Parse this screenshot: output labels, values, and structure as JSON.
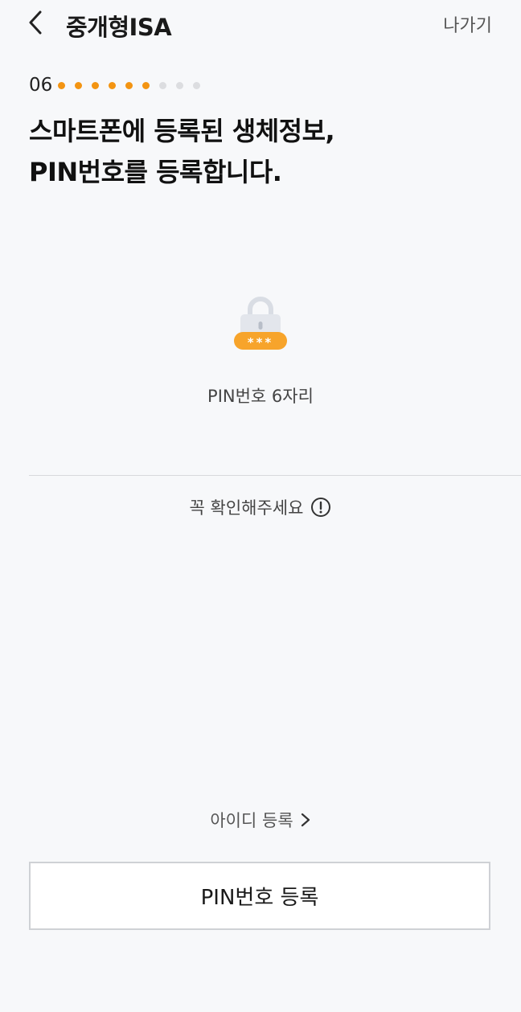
{
  "header": {
    "back_icon": "chevron-left-icon",
    "title": "중개형ISA",
    "exit_label": "나가기"
  },
  "progress": {
    "step": "06",
    "completed_dots": 6,
    "total_dots": 9,
    "active_color": "#f39412",
    "inactive_color": "#dcdde0"
  },
  "headline": {
    "line1": "스마트폰에 등록된 생체정보,",
    "line2": "PIN번호를 등록합니다."
  },
  "pin": {
    "icon": "lock-icon",
    "mask": "***",
    "caption": "PIN번호 6자리"
  },
  "notice": {
    "label": "꼭 확인해주세요",
    "icon": "exclamation-circle-icon"
  },
  "id_register": {
    "label": "아이디 등록",
    "icon": "chevron-right-icon"
  },
  "primary_button": {
    "label": "PIN번호 등록"
  },
  "colors": {
    "background": "#f7f8fa",
    "accent": "#f39412"
  }
}
